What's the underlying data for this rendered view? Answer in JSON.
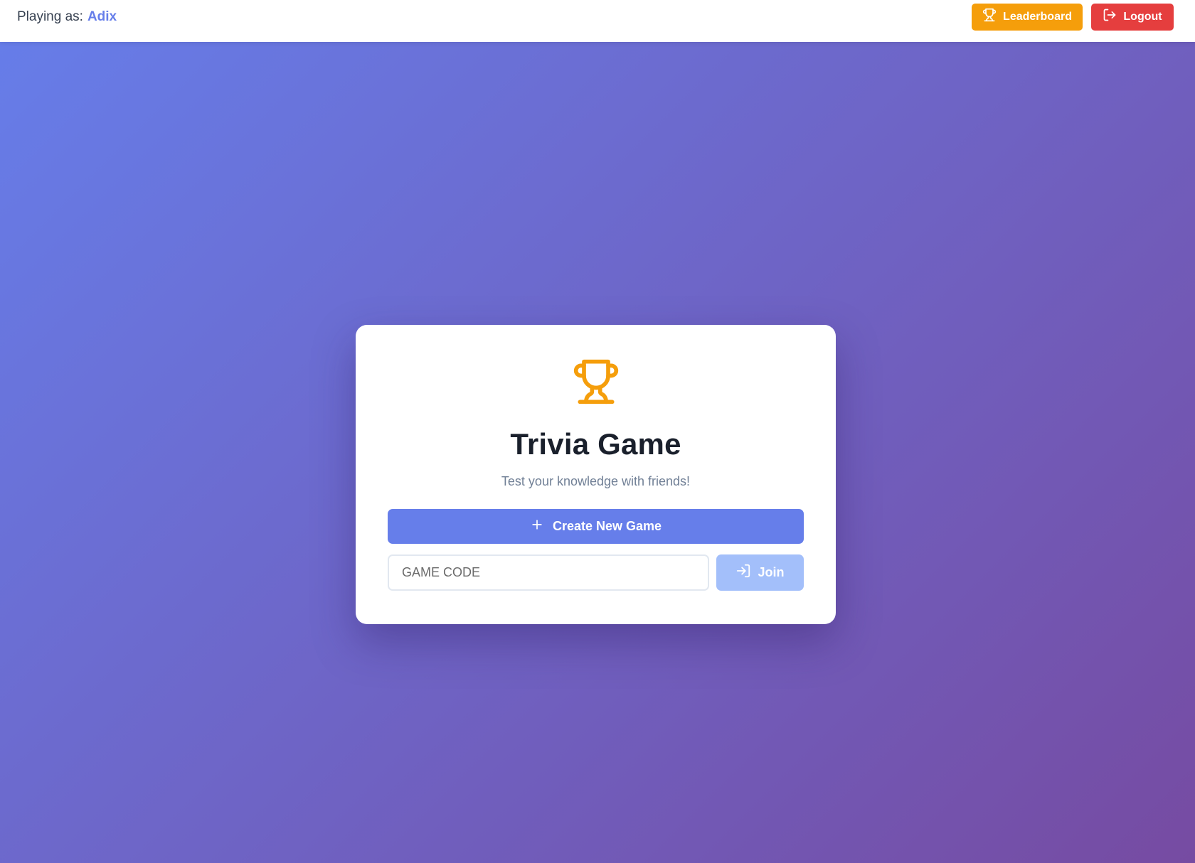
{
  "header": {
    "playing_as_label": "Playing as:",
    "player_name": "Adix",
    "leaderboard_label": "Leaderboard",
    "logout_label": "Logout",
    "leaderboard_icon": "trophy-icon",
    "logout_icon": "log-out-icon"
  },
  "card": {
    "icon": "trophy-icon",
    "title": "Trivia Game",
    "subtitle": "Test your knowledge with friends!",
    "create_label": "Create New Game",
    "create_icon": "plus-icon",
    "code_placeholder": "GAME CODE",
    "code_value": "",
    "join_label": "Join",
    "join_icon": "log-in-icon"
  },
  "colors": {
    "gradient_start": "#667eea",
    "gradient_end": "#764ba2",
    "accent": "#667eea",
    "leaderboard": "#f59e0b",
    "logout": "#e53e3e",
    "join_disabled": "#a3bffa",
    "trophy": "#f59e0b"
  }
}
